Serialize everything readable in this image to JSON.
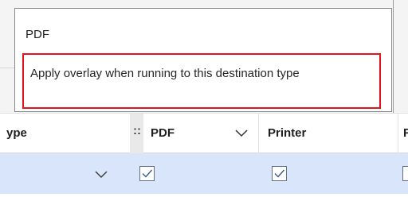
{
  "tooltip": {
    "title": "PDF",
    "description": "Apply overlay when running to this destination type",
    "highlight_color": "#e0141d"
  },
  "grid": {
    "columns": [
      {
        "label": "ype"
      },
      {
        "label": "PDF"
      },
      {
        "label": "Printer"
      },
      {
        "label": "F"
      }
    ],
    "column_grip": "::",
    "row": {
      "type_value": "",
      "pdf_checked": true,
      "printer_checked": true
    },
    "selected_row_color": "#d8e5fb"
  },
  "icons": {
    "pdf_header": "chevron-down-icon",
    "type_cell": "chevron-down-icon",
    "checked": "checkmark-icon"
  }
}
